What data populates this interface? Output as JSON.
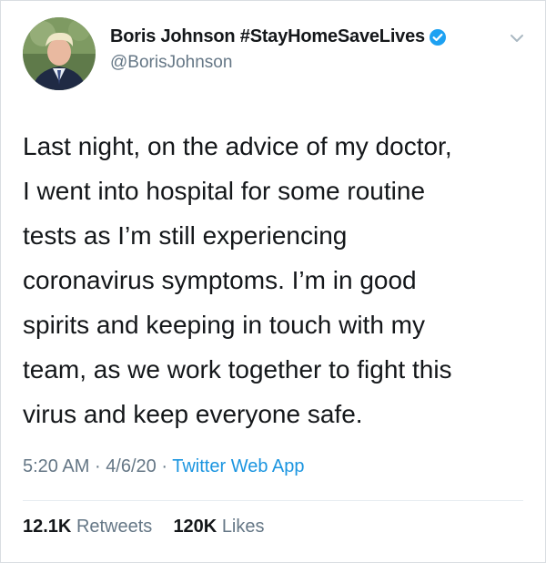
{
  "tweet": {
    "author": {
      "display_name": "Boris Johnson #StayHomeSaveLives",
      "handle": "@BorisJohnson",
      "verified": true,
      "verified_color": "#1da1f2"
    },
    "text": "Last night, on the advice of my doctor,\nI went into hospital for some routine\ntests as I’m still experiencing\ncoronavirus symptoms. I’m in good\nspirits and keeping in touch with my\nteam, as we work together to fight this\nvirus and keep everyone safe.",
    "time": "5:20 AM",
    "date": "4/6/20",
    "separator": "·",
    "source": "Twitter Web App",
    "source_color": "#1b95e0",
    "retweets": {
      "count": "12.1K",
      "label": "Retweets"
    },
    "likes": {
      "count": "120K",
      "label": "Likes"
    }
  },
  "icons": {
    "avatar": "profile-photo",
    "verified": "verified-badge-icon",
    "menu": "chevron-down-icon"
  }
}
